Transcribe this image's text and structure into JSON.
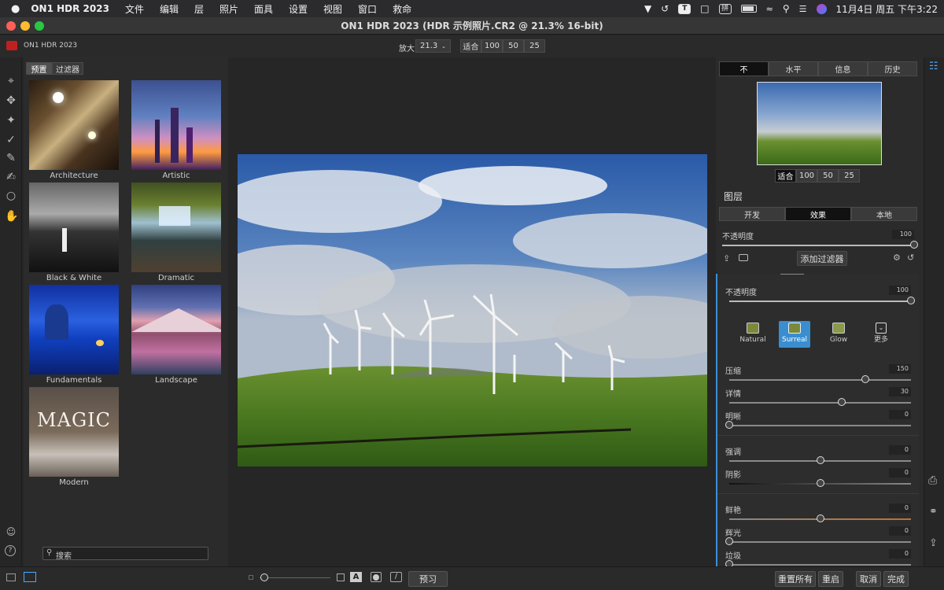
{
  "menubar": {
    "app": "ON1 HDR 2023",
    "items": [
      "文件",
      "编辑",
      "层",
      "照片",
      "面具",
      "设置",
      "视图",
      "窗口",
      "救命"
    ],
    "datetime": "11月4日 周五 下午3:22"
  },
  "window": {
    "title": "ON1 HDR 2023 (HDR 示例照片.CR2 @ 21.3% 16-bit)",
    "app_label": "ON1 HDR 2023"
  },
  "toolbar": {
    "zoom_label": "放大",
    "zoom_value": "21.3",
    "zoom_presets": [
      "适合",
      "100",
      "50",
      "25"
    ]
  },
  "browser": {
    "tabs": [
      "预置",
      "过滤器"
    ],
    "presets": [
      "Architecture",
      "Artistic",
      "Black & White",
      "Dramatic",
      "Fundamentals",
      "Landscape",
      "Modern"
    ],
    "modern_overlay": "MAGIC",
    "search_placeholder": "搜索"
  },
  "navigator": {
    "tabs": [
      "不",
      "水平",
      "信息",
      "历史"
    ],
    "zoom_presets": [
      "适合",
      "100",
      "50",
      "25"
    ]
  },
  "layers": {
    "title": "图层",
    "tabs": [
      "开发",
      "效果",
      "本地"
    ],
    "opacity_label": "不透明度",
    "opacity_value": "100",
    "opacity_fraction": 1.0,
    "add_filter": "添加过滤器"
  },
  "filter": {
    "opacity_label": "不透明度",
    "opacity_value": "100",
    "opacity_fraction": 1.0,
    "styles": [
      "Natural",
      "Surreal",
      "Glow",
      "更多"
    ],
    "selected_style": "Surreal",
    "sliders": [
      {
        "label": "压缩",
        "value": "150",
        "fraction": 0.75
      },
      {
        "label": "详情",
        "value": "30",
        "fraction": 0.62
      },
      {
        "label": "明晰",
        "value": "0",
        "fraction": 0.0
      },
      {
        "label": "强调",
        "value": "0",
        "fraction": 0.5
      },
      {
        "label": "阴影",
        "value": "0",
        "fraction": 0.5
      },
      {
        "label": "鲜艳",
        "value": "0",
        "fraction": 0.5
      },
      {
        "label": "辉光",
        "value": "0",
        "fraction": 0.0
      },
      {
        "label": "垃圾",
        "value": "0",
        "fraction": 0.0
      }
    ]
  },
  "bottombar": {
    "preview": "预习",
    "text_toggle": "A",
    "actions": [
      "重置所有",
      "重启",
      "取消",
      "完成"
    ]
  }
}
